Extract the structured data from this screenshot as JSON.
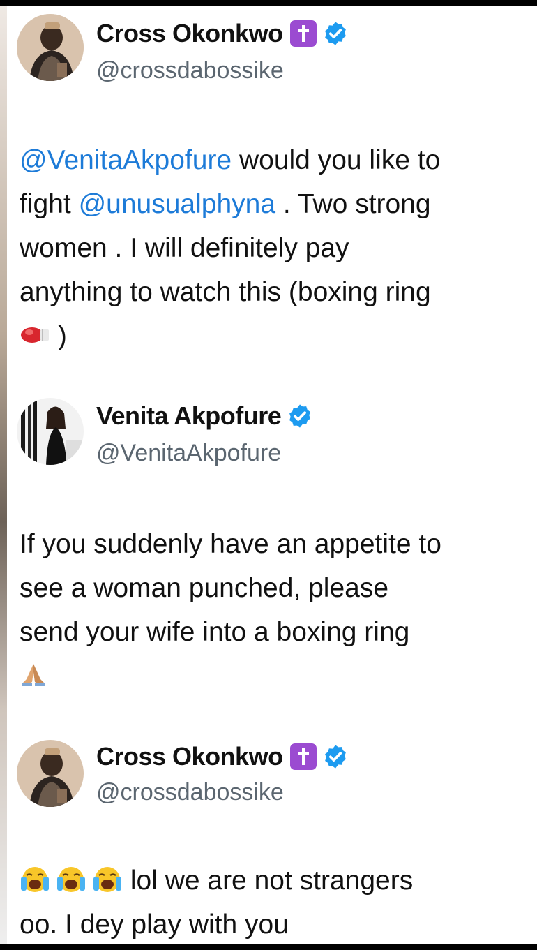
{
  "tweets": [
    {
      "display_name": "Cross Okonkwo",
      "handle": "@crossdabossike",
      "badges": [
        "cross-badge",
        "verified-badge"
      ],
      "body": {
        "line1_mention": "@VenitaAkpofure",
        "line1_text": " would you like to",
        "line2_prefix": "fight ",
        "line2_mention": "@unusualphyna",
        "line2_text": " . Two strong",
        "line3": "women . I will definitely pay",
        "line4": "anything to watch this (boxing ring",
        "line5_emoji": "boxing-glove-emoji",
        "line5_text": " )"
      }
    },
    {
      "display_name": "Venita Akpofure",
      "handle": "@VenitaAkpofure",
      "badges": [
        "verified-badge"
      ],
      "body": {
        "line1": "If you suddenly have an appetite to",
        "line2": "see a woman punched, please",
        "line3": "send your wife into a boxing ring",
        "line4_emoji": "folded-hands-emoji"
      }
    },
    {
      "display_name": "Cross Okonkwo",
      "handle": "@crossdabossike",
      "badges": [
        "cross-badge",
        "verified-badge"
      ],
      "body": {
        "line1_emojis": [
          "loudly-crying-face-emoji",
          "loudly-crying-face-emoji",
          "loudly-crying-face-emoji"
        ],
        "line1_text": " lol we are not strangers",
        "line2": "oo. I dey play with you"
      }
    }
  ],
  "colors": {
    "mention": "#1d7bd8",
    "verified": "#1d9bf0",
    "cross_badge": "#9b4bd1",
    "handle": "#5b6670",
    "text": "#111111"
  }
}
